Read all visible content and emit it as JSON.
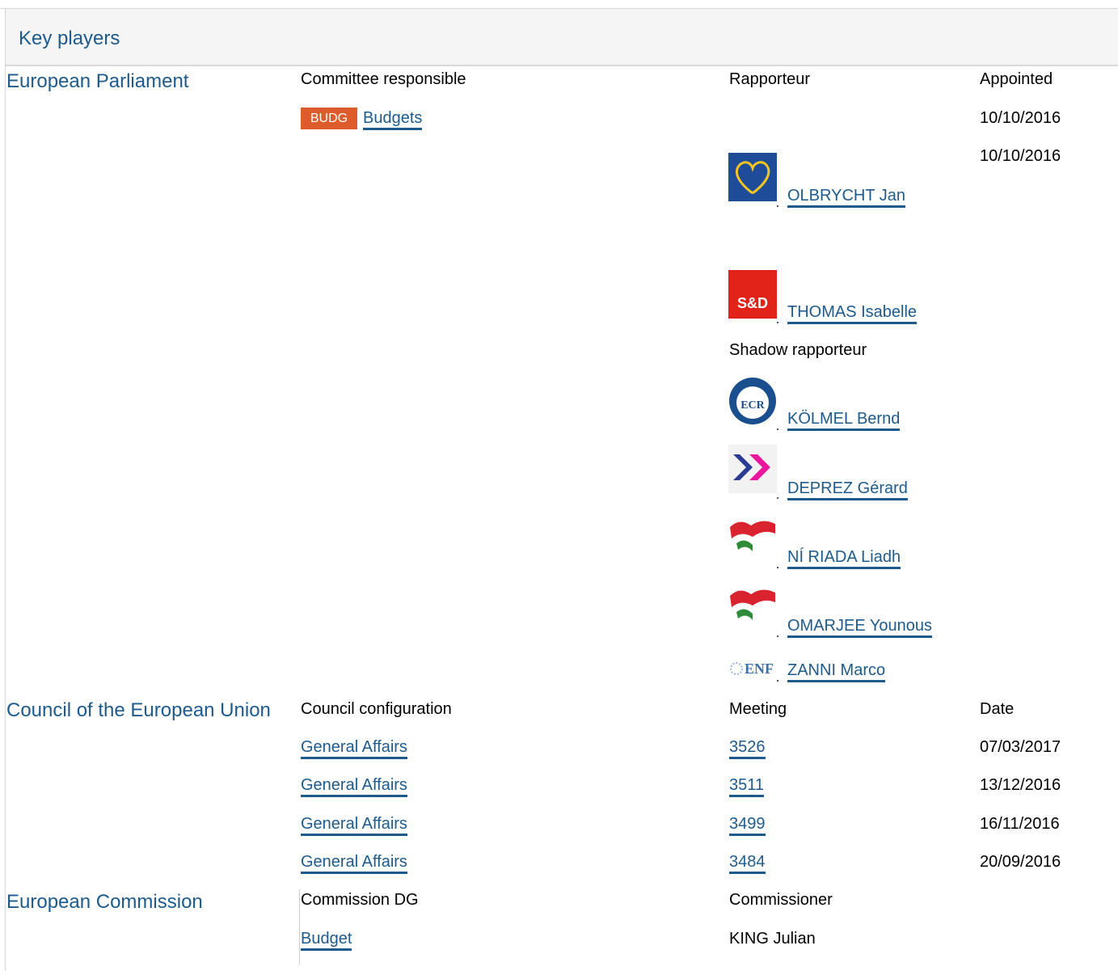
{
  "header": {
    "title": "Key players"
  },
  "parliament": {
    "label": "European Parliament",
    "col_committee": "Committee responsible",
    "col_rapporteur": "Rapporteur",
    "col_appointed": "Appointed",
    "committee_badge": "BUDG",
    "committee_name": "Budgets",
    "committee_date": "10/10/2016",
    "rapporteur_date": "10/10/2016",
    "rapporteurs": [
      {
        "name": "OLBRYCHT Jan",
        "group_icon": "epp-heart-icon"
      },
      {
        "name": "THOMAS Isabelle",
        "group_icon": "sd-logo-icon"
      }
    ],
    "shadow_label": "Shadow rapporteur",
    "shadows": [
      {
        "name": "KÖLMEL Bernd",
        "group_icon": "ecr-logo-icon"
      },
      {
        "name": "DEPREZ Gérard",
        "group_icon": "alde-arrows-icon"
      },
      {
        "name": "NÍ RIADA Liadh",
        "group_icon": "gue-flag-icon"
      },
      {
        "name": "OMARJEE Younous",
        "group_icon": "gue-flag-icon"
      },
      {
        "name": "ZANNI Marco",
        "group_icon": "enf-logo-icon"
      }
    ]
  },
  "council": {
    "label": "Council of the European Union",
    "col_config": "Council configuration",
    "col_meeting": "Meeting",
    "col_date": "Date",
    "rows": [
      {
        "config": "General Affairs",
        "meeting": "3526",
        "date": "07/03/2017"
      },
      {
        "config": "General Affairs",
        "meeting": "3511",
        "date": "13/12/2016"
      },
      {
        "config": "General Affairs",
        "meeting": "3499",
        "date": "16/11/2016"
      },
      {
        "config": "General Affairs",
        "meeting": "3484",
        "date": "20/09/2016"
      }
    ]
  },
  "commission": {
    "label": "European Commission",
    "col_dg": "Commission DG",
    "col_commissioner": "Commissioner",
    "dg": "Budget",
    "commissioner": "KING Julian"
  },
  "colors": {
    "link": "#1e5a8c",
    "badge": "#de5b2b",
    "header_bg": "#f5f5f5"
  }
}
